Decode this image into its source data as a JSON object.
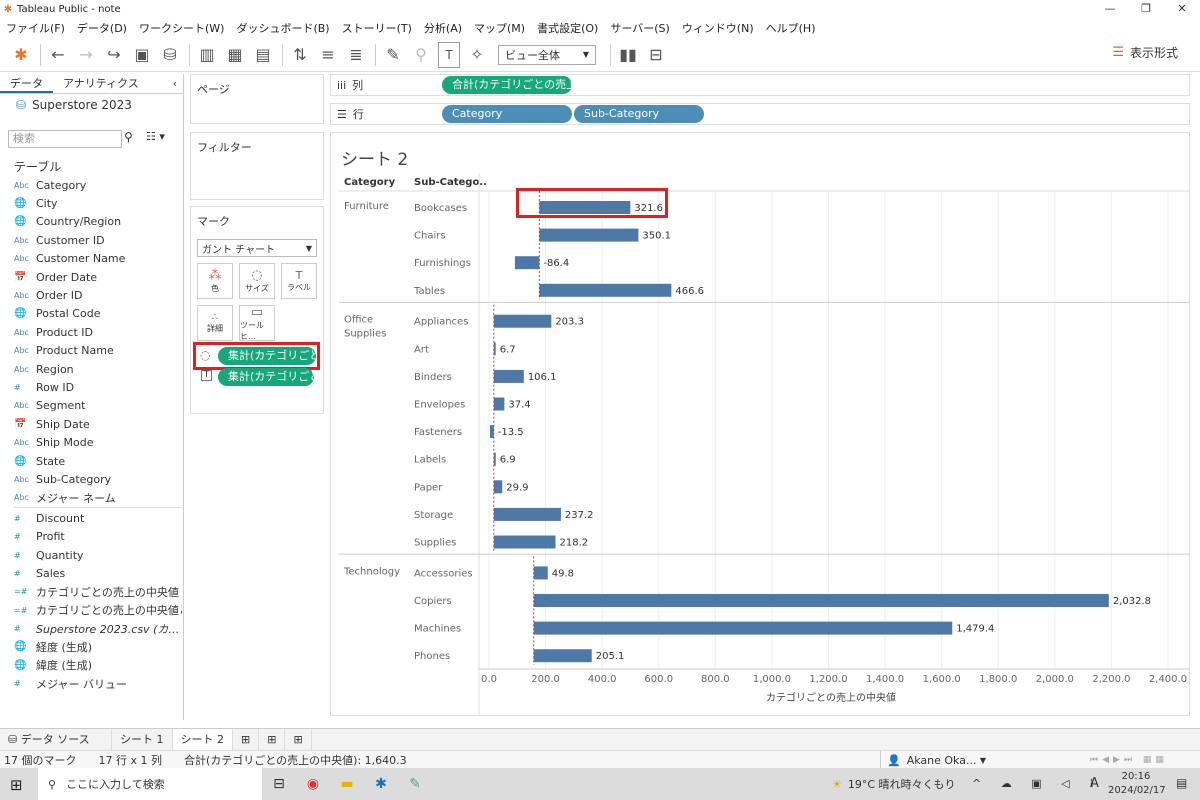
{
  "window": {
    "title": "Tableau Public - note",
    "min": "—",
    "max": "❐",
    "close": "✕"
  },
  "menu": [
    "ファイル(F)",
    "データ(D)",
    "ワークシート(W)",
    "ダッシュボード(B)",
    "ストーリー(T)",
    "分析(A)",
    "マップ(M)",
    "書式設定(O)",
    "サーバー(S)",
    "ウィンドウ(N)",
    "ヘルプ(H)"
  ],
  "toolbar": {
    "view_select": "ビュー全体",
    "show_me": "表示形式"
  },
  "left": {
    "tab_data": "データ",
    "tab_analytics": "アナリティクス",
    "datasource": "Superstore 2023",
    "search_placeholder": "検索",
    "tables_header": "テーブル",
    "dimensions": [
      {
        "type": "Abc",
        "name": "Category"
      },
      {
        "type": "geo",
        "name": "City"
      },
      {
        "type": "geo",
        "name": "Country/Region"
      },
      {
        "type": "Abc",
        "name": "Customer ID"
      },
      {
        "type": "Abc",
        "name": "Customer Name"
      },
      {
        "type": "date",
        "name": "Order Date"
      },
      {
        "type": "Abc",
        "name": "Order ID"
      },
      {
        "type": "geo",
        "name": "Postal Code"
      },
      {
        "type": "Abc",
        "name": "Product ID"
      },
      {
        "type": "Abc",
        "name": "Product Name"
      },
      {
        "type": "Abc",
        "name": "Region"
      },
      {
        "type": "#",
        "name": "Row ID"
      },
      {
        "type": "Abc",
        "name": "Segment"
      },
      {
        "type": "date",
        "name": "Ship Date"
      },
      {
        "type": "Abc",
        "name": "Ship Mode"
      },
      {
        "type": "geo",
        "name": "State"
      },
      {
        "type": "Abc",
        "name": "Sub-Category"
      },
      {
        "type": "Abc",
        "name": "メジャー ネーム"
      }
    ],
    "measures": [
      {
        "type": "#",
        "name": "Discount"
      },
      {
        "type": "#",
        "name": "Profit"
      },
      {
        "type": "#",
        "name": "Quantity"
      },
      {
        "type": "#",
        "name": "Sales"
      },
      {
        "type": "=#",
        "name": "カテゴリごとの売上の中央値"
      },
      {
        "type": "=#",
        "name": "カテゴリごとの売上の中央値と…"
      },
      {
        "type": "#",
        "name": "Superstore 2023.csv (カ…"
      },
      {
        "type": "geo",
        "name": "経度 (生成)"
      },
      {
        "type": "geo",
        "name": "緯度 (生成)"
      },
      {
        "type": "#",
        "name": "メジャー バリュー"
      }
    ]
  },
  "cards": {
    "pages": "ページ",
    "filters": "フィルター",
    "marks": "マーク",
    "mark_type": "ガント チャート",
    "btn_color": "色",
    "btn_size": "サイズ",
    "btn_label": "ラベル",
    "btn_detail": "詳細",
    "btn_tooltip": "ツールヒ…",
    "mark_pill_1": "集計(カテゴリごと…",
    "mark_pill_2": "集計(カテゴリごと…"
  },
  "shelves": {
    "columns_label": "列",
    "rows_label": "行",
    "columns_pill": "合計(カテゴリごとの売上…",
    "rows_pill_1": "Category",
    "rows_pill_2": "Sub-Category"
  },
  "sheet": {
    "title": "シート 2",
    "hdr_category": "Category",
    "hdr_subcategory": "Sub-Catego.."
  },
  "chart_data": {
    "type": "bar",
    "xlabel": "カテゴリごとの売上の中央値",
    "xlim": [
      0,
      2400
    ],
    "xticks": [
      "0.0",
      "200.0",
      "400.0",
      "600.0",
      "800.0",
      "1,000.0",
      "1,200.0",
      "1,400.0",
      "1,600.0",
      "1,800.0",
      "2,000.0",
      "2,200.0",
      "2,400.0"
    ],
    "groups": [
      {
        "category": "Furniture",
        "median": 178,
        "rows": [
          {
            "sub": "Bookcases",
            "value": 321.6,
            "label": "321.6"
          },
          {
            "sub": "Chairs",
            "value": 350.1,
            "label": "350.1"
          },
          {
            "sub": "Furnishings",
            "value": -86.4,
            "label": "-86.4"
          },
          {
            "sub": "Tables",
            "value": 466.6,
            "label": "466.6"
          }
        ]
      },
      {
        "category": "Office Supplies",
        "median": 17,
        "rows": [
          {
            "sub": "Appliances",
            "value": 203.3,
            "label": "203.3"
          },
          {
            "sub": "Art",
            "value": 6.7,
            "label": "6.7"
          },
          {
            "sub": "Binders",
            "value": 106.1,
            "label": "106.1"
          },
          {
            "sub": "Envelopes",
            "value": 37.4,
            "label": "37.4"
          },
          {
            "sub": "Fasteners",
            "value": -13.5,
            "label": "-13.5"
          },
          {
            "sub": "Labels",
            "value": 6.9,
            "label": "6.9"
          },
          {
            "sub": "Paper",
            "value": 29.9,
            "label": "29.9"
          },
          {
            "sub": "Storage",
            "value": 237.2,
            "label": "237.2"
          },
          {
            "sub": "Supplies",
            "value": 218.2,
            "label": "218.2"
          }
        ]
      },
      {
        "category": "Technology",
        "median": 158,
        "rows": [
          {
            "sub": "Accessories",
            "value": 49.8,
            "label": "49.8"
          },
          {
            "sub": "Copiers",
            "value": 2032.8,
            "label": "2,032.8"
          },
          {
            "sub": "Machines",
            "value": 1479.4,
            "label": "1,479.4"
          },
          {
            "sub": "Phones",
            "value": 205.1,
            "label": "205.1"
          }
        ]
      }
    ],
    "bar_color": "#4e79a7",
    "ref_line_color": "#e03030"
  },
  "bottom": {
    "datasource_tab": "データ ソース",
    "sheet1": "シート 1",
    "sheet2": "シート 2"
  },
  "status": {
    "marks": "17 個のマーク",
    "rowscols": "17 行 x 1 列",
    "sum": "合計(カテゴリごとの売上の中央値): 1,640.3",
    "user": "Akane Oka..."
  },
  "taskbar": {
    "search": "ここに入力して検索",
    "temp": "19°C 晴れ時々くもり",
    "time": "20:16",
    "date": "2024/02/17",
    "ime": "A"
  }
}
